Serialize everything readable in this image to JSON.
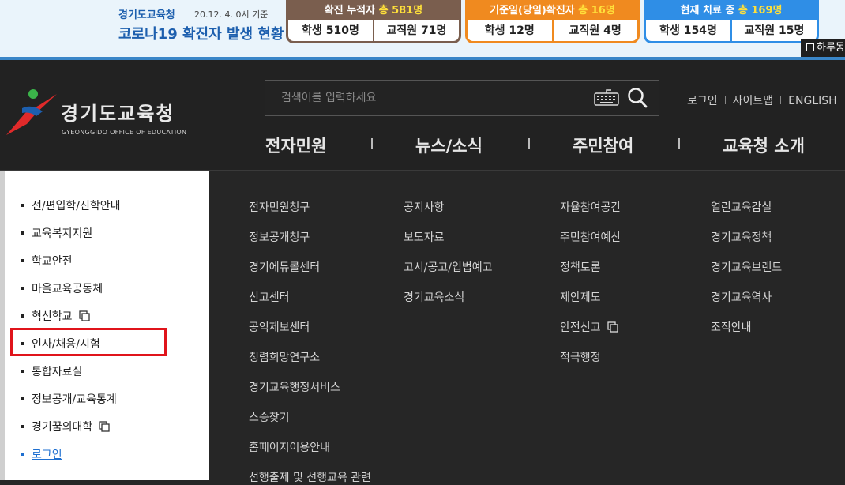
{
  "banner": {
    "org": "경기도교육청",
    "date": "20.12. 4. 0시 기준",
    "title": "코로나19 확진자 발생 현황",
    "boxes": [
      {
        "label": "확진 누적자 ",
        "total": "총 581명",
        "students": "학생 510명",
        "staff": "교직원 71명",
        "color": "#7a5e4e"
      },
      {
        "label": "기준일(당일)확진자 ",
        "total": "총 16명",
        "students": "학생 12명",
        "staff": "교직원 4명",
        "color": "#f08a1f"
      },
      {
        "label": "현재 치료 중 ",
        "total": "총 169명",
        "students": "학생 154명",
        "staff": "교직원 15명",
        "color": "#2f8ee6"
      }
    ],
    "no_show": "하루동"
  },
  "header": {
    "logo_text": "경기도교육청",
    "logo_sub": "GYEONGGIDO OFFICE OF EDUCATION",
    "search_placeholder": "검색어를 입력하세요",
    "util": [
      "로그인",
      "사이트맵",
      "ENGLISH"
    ],
    "gnb": [
      "전자민원",
      "뉴스/소식",
      "주민참여",
      "교육청 소개"
    ]
  },
  "left_menu": [
    "전/편입학/진학안내",
    "교육복지지원",
    "학교안전",
    "마을교육공동체",
    "혁신학교",
    "인사/채용/시험",
    "통합자료실",
    "정보공개/교육통계",
    "경기꿈의대학",
    "로그인"
  ],
  "submenus": {
    "col1": [
      "전자민원청구",
      "정보공개청구",
      "경기에듀콜센터",
      "신고센터",
      "공익제보센터",
      "청렴희망연구소",
      "경기교육행정서비스",
      "스승찾기",
      "홈페이지이용안내",
      "선행출제 및 선행교육 관련"
    ],
    "col2": [
      "공지사항",
      "보도자료",
      "고시/공고/입법예고",
      "경기교육소식"
    ],
    "col3": [
      "자율참여공간",
      "주민참여예산",
      "정책토론",
      "제안제도",
      "안전신고",
      "적극행정"
    ],
    "col4": [
      "열린교육감실",
      "경기교육정책",
      "경기교육브랜드",
      "경기교육역사",
      "조직안내"
    ]
  }
}
